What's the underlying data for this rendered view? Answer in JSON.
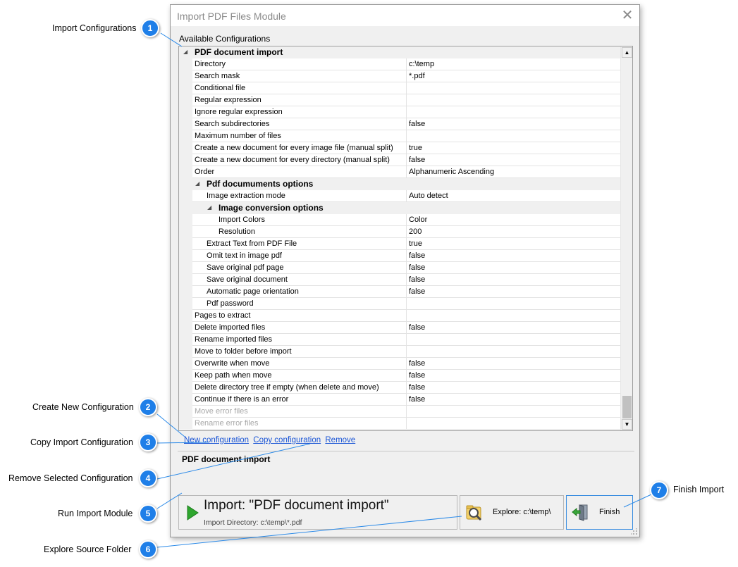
{
  "dialog": {
    "title": "Import PDF Files Module",
    "available_label": "Available Configurations"
  },
  "grid": {
    "rows": [
      {
        "type": "category",
        "depth": 1,
        "name": "PDF document import",
        "value": ""
      },
      {
        "type": "prop",
        "depth": 1,
        "name": "Directory",
        "value": "c:\\temp"
      },
      {
        "type": "prop",
        "depth": 1,
        "name": "Search mask",
        "value": "*.pdf"
      },
      {
        "type": "prop",
        "depth": 1,
        "name": "Conditional file",
        "value": ""
      },
      {
        "type": "prop",
        "depth": 1,
        "name": "Regular expression",
        "value": ""
      },
      {
        "type": "prop",
        "depth": 1,
        "name": "Ignore regular expression",
        "value": ""
      },
      {
        "type": "prop",
        "depth": 1,
        "name": "Search subdirectories",
        "value": "false"
      },
      {
        "type": "prop",
        "depth": 1,
        "name": "Maximum number of files",
        "value": ""
      },
      {
        "type": "prop",
        "depth": 1,
        "name": "Create a new document for every image file (manual split)",
        "value": "true"
      },
      {
        "type": "prop",
        "depth": 1,
        "name": "Create a new document for every directory (manual split)",
        "value": "false"
      },
      {
        "type": "prop",
        "depth": 1,
        "name": "Order",
        "value": "Alphanumeric Ascending"
      },
      {
        "type": "category",
        "depth": 2,
        "name": "Pdf documuments options",
        "value": ""
      },
      {
        "type": "prop",
        "depth": 2,
        "name": "Image extraction mode",
        "value": "Auto detect"
      },
      {
        "type": "category",
        "depth": 3,
        "name": "Image conversion options",
        "value": ""
      },
      {
        "type": "prop",
        "depth": 3,
        "name": "Import Colors",
        "value": "Color"
      },
      {
        "type": "prop",
        "depth": 3,
        "name": "Resolution",
        "value": "200"
      },
      {
        "type": "prop",
        "depth": 2,
        "name": "Extract Text from PDF File",
        "value": "true"
      },
      {
        "type": "prop",
        "depth": 2,
        "name": "Omit text in image pdf",
        "value": "false"
      },
      {
        "type": "prop",
        "depth": 2,
        "name": "Save original pdf page",
        "value": "false"
      },
      {
        "type": "prop",
        "depth": 2,
        "name": "Save original document",
        "value": "false"
      },
      {
        "type": "prop",
        "depth": 2,
        "name": "Automatic page orientation",
        "value": "false"
      },
      {
        "type": "prop",
        "depth": 2,
        "name": "Pdf password",
        "value": ""
      },
      {
        "type": "prop",
        "depth": 1,
        "name": "Pages to extract",
        "value": ""
      },
      {
        "type": "prop",
        "depth": 1,
        "name": "Delete imported files",
        "value": "false"
      },
      {
        "type": "prop",
        "depth": 1,
        "name": "Rename imported files",
        "value": ""
      },
      {
        "type": "prop",
        "depth": 1,
        "name": "Move to folder before import",
        "value": ""
      },
      {
        "type": "prop",
        "depth": 1,
        "name": "Overwrite when move",
        "value": "false"
      },
      {
        "type": "prop",
        "depth": 1,
        "name": "Keep path when move",
        "value": "false"
      },
      {
        "type": "prop",
        "depth": 1,
        "name": "Delete directory tree if empty (when delete and move)",
        "value": "false"
      },
      {
        "type": "prop",
        "depth": 1,
        "name": "Continue if there is an error",
        "value": "false"
      },
      {
        "type": "disabled",
        "depth": 1,
        "name": "Move error files",
        "value": ""
      },
      {
        "type": "disabled",
        "depth": 1,
        "name": "Rename error files",
        "value": ""
      }
    ]
  },
  "links": {
    "new": "New configuration",
    "copy": "Copy configuration",
    "remove": "Remove"
  },
  "description": {
    "title": "PDF document import"
  },
  "buttons": {
    "import_title": "Import: \"PDF document import\"",
    "import_sub": "Import Directory: c:\\temp\\*.pdf",
    "explore": "Explore: c:\\temp\\",
    "finish": "Finish"
  },
  "callouts": [
    {
      "num": "1",
      "label": "Import Configurations"
    },
    {
      "num": "2",
      "label": "Create New Configuration"
    },
    {
      "num": "3",
      "label": "Copy Import Configuration"
    },
    {
      "num": "4",
      "label": "Remove Selected Configuration"
    },
    {
      "num": "5",
      "label": "Run Import Module"
    },
    {
      "num": "6",
      "label": "Explore Source Folder"
    },
    {
      "num": "7",
      "label": "Finish Import"
    }
  ],
  "colors": {
    "accent": "#1f7fe8",
    "link": "#1a55d6",
    "play_green": "#2ea62e"
  },
  "icons": {
    "play": "play-icon",
    "explore": "magnifier-folder-icon",
    "finish": "exit-door-icon",
    "close": "close-icon"
  }
}
